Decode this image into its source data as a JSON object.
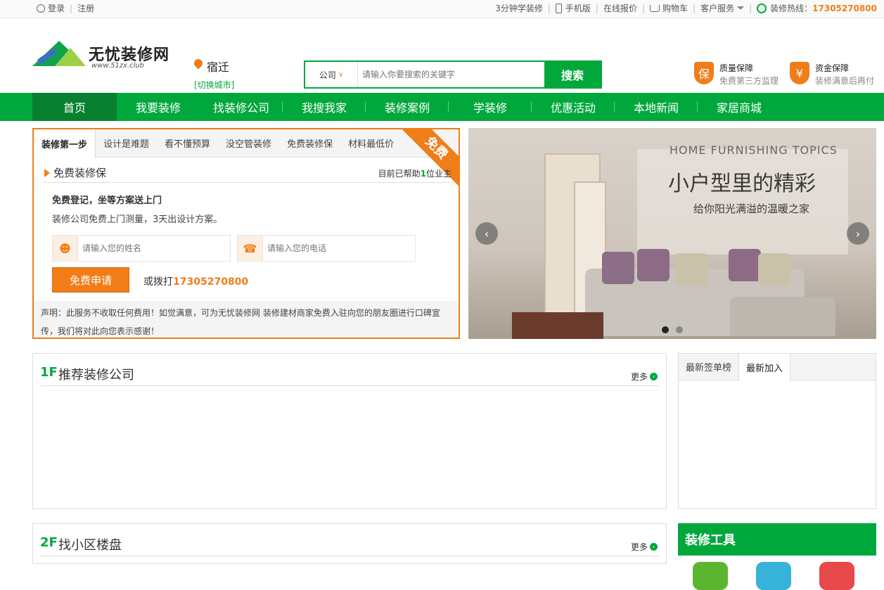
{
  "topbar": {
    "login": "登录",
    "register": "注册",
    "learn3min": "3分钟学装修",
    "mobile": "手机版",
    "quote": "在线报价",
    "cart": "购物车",
    "service": "客户服务",
    "hotline_label": "装修热线：",
    "hotline_number": "17305270800"
  },
  "header": {
    "logo_name": "无忧装修网",
    "logo_url": "www.51zx.club",
    "city": "宿迁",
    "switch_city": "[切换城市]",
    "search_category": "公司",
    "search_placeholder": "请输入你要搜索的关键字",
    "search_button": "搜索",
    "guarantees": [
      {
        "icon": "保",
        "title": "质量保障",
        "desc": "免费第三方监理"
      },
      {
        "icon": "¥",
        "title": "资金保障",
        "desc": "装修满意后再付"
      }
    ]
  },
  "nav": {
    "items": [
      "首页",
      "我要装修",
      "找装修公司",
      "我搜我家",
      "装修案例",
      "学装修",
      "优惠活动",
      "本地新闻",
      "家居商城"
    ]
  },
  "panel": {
    "tabs": [
      "装修第一步",
      "设计是难题",
      "看不懂预算",
      "没空管装修",
      "免费装修保",
      "材料最低价"
    ],
    "ribbon": "免费",
    "section_title": "免费装修保",
    "helped_prefix": "目前已帮助",
    "helped_count": "1",
    "helped_suffix": "位业主",
    "lead1": "免费登记，坐等方案送上门",
    "lead2": "装修公司免费上门测量，3天出设计方案。",
    "name_placeholder": "请输入您的姓名",
    "phone_placeholder": "请输入您的电话",
    "apply_button": "免费申请",
    "or_call": "或拨打",
    "phone_number": "17305270800",
    "notice": "声明：此服务不收取任何费用！如觉满意，可为无忧装修网 装修建材商家免费入驻向您的朋友圈进行口碑宣传，我们将对此向您表示感谢！"
  },
  "banner": {
    "en_title": "HOME FURNISHING TOPICS",
    "cn_title": "小户型里的精彩",
    "subtitle": "给你阳光满溢的温暖之家",
    "prev": "‹",
    "next": "›"
  },
  "floors": [
    {
      "num": "1F",
      "title": "推荐装修公司",
      "more": "更多"
    },
    {
      "num": "2F",
      "title": "找小区楼盘",
      "more": "更多"
    }
  ],
  "ranking": {
    "tabs": [
      "最新签单榜",
      "最新加入"
    ]
  },
  "tools": {
    "title": "装修工具"
  },
  "colors": {
    "brand_green": "#00a83c",
    "accent_orange": "#f07d18"
  }
}
